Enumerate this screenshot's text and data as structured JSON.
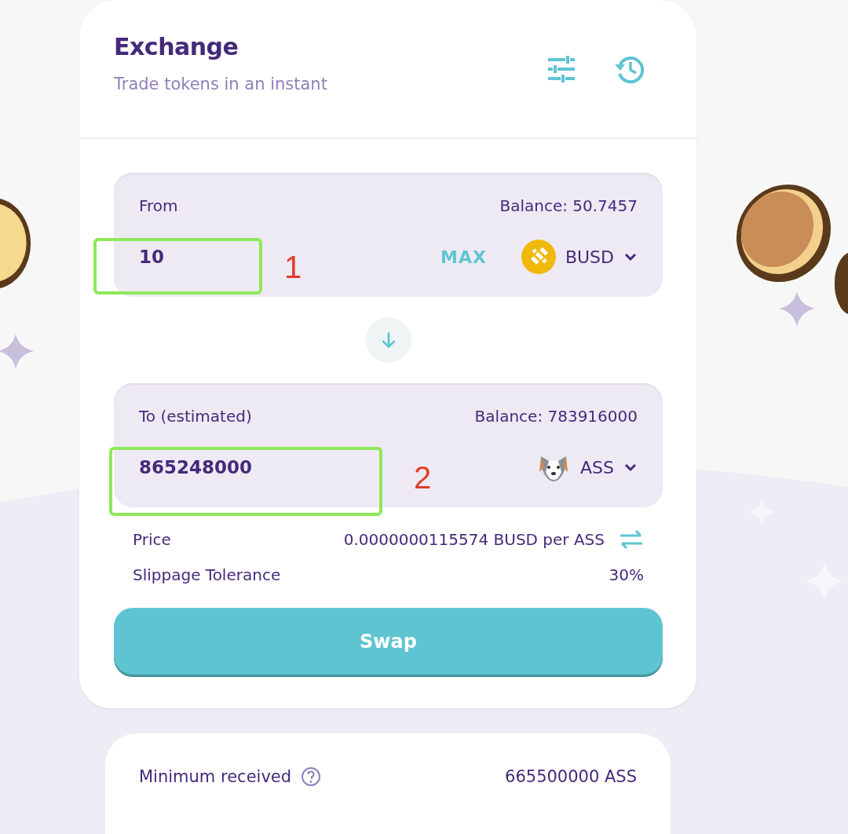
{
  "header": {
    "title": "Exchange",
    "subtitle": "Trade tokens in an instant"
  },
  "from": {
    "label": "From",
    "balance": "Balance: 50.7457",
    "amount": "10",
    "max": "MAX",
    "token": {
      "symbol": "BUSD",
      "kind": "busd"
    },
    "annotation": "1"
  },
  "to": {
    "label": "To (estimated)",
    "balance": "Balance: 783916000",
    "amount": "865248000",
    "token": {
      "symbol": "ASS",
      "kind": "dog"
    },
    "annotation": "2"
  },
  "price": {
    "label": "Price",
    "value": "0.0000000115574 BUSD per ASS"
  },
  "slippage": {
    "label": "Slippage Tolerance",
    "value": "30%"
  },
  "swap_button": "Swap",
  "details": {
    "label": "Minimum received",
    "value": "665500000 ASS"
  }
}
